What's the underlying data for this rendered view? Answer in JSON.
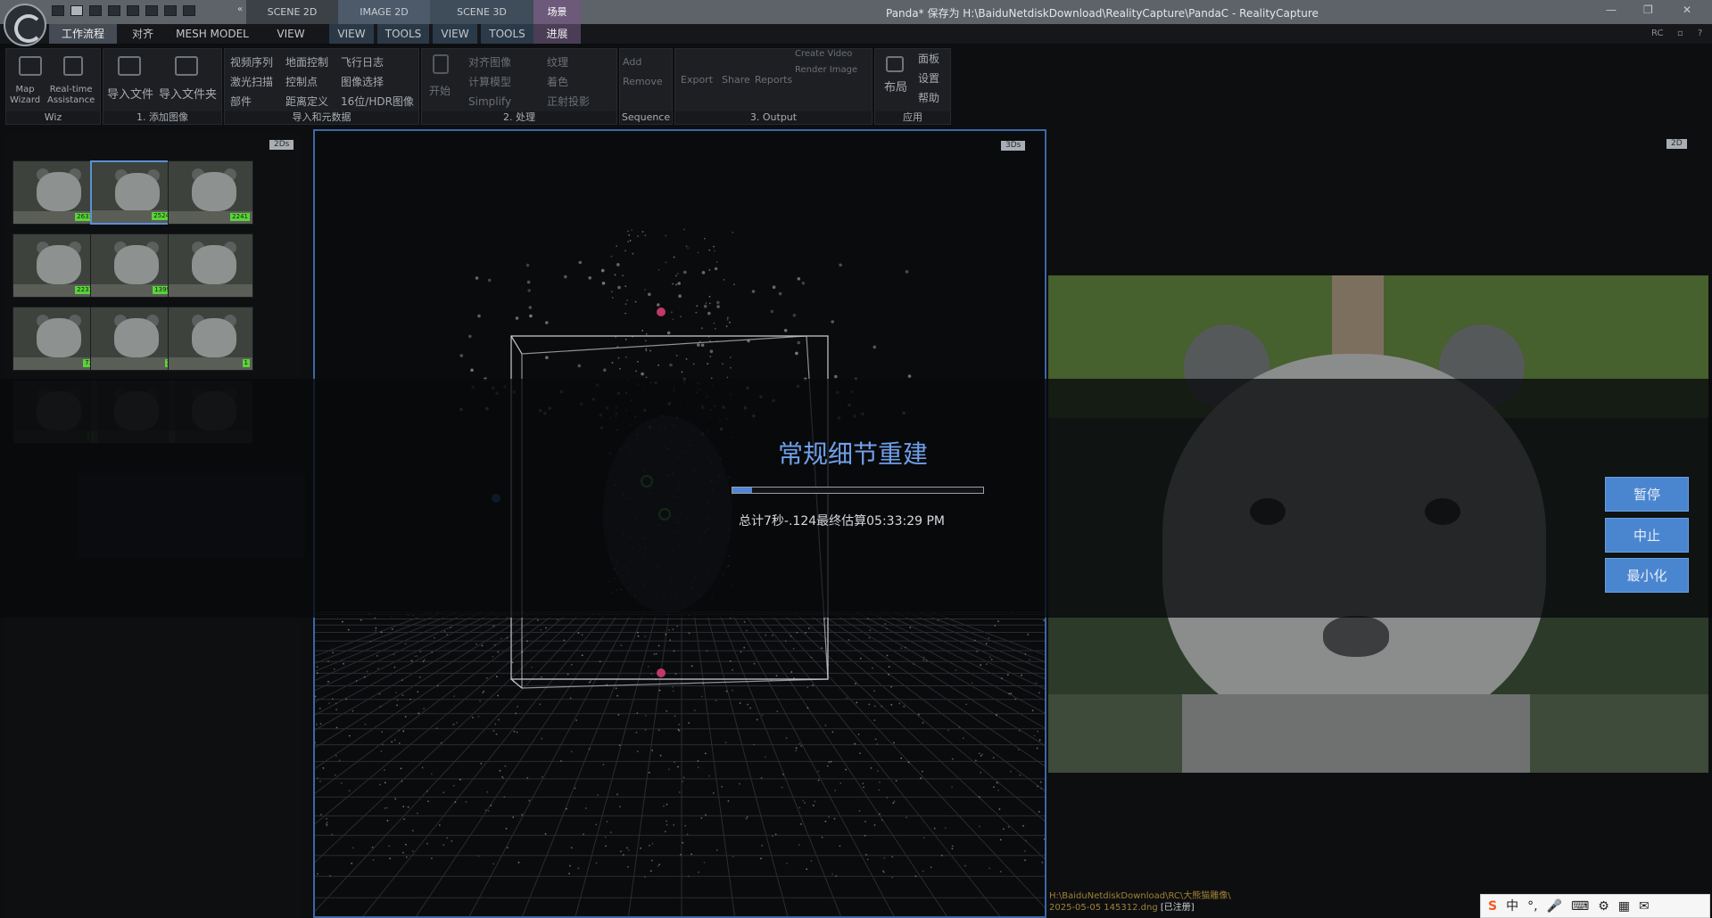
{
  "window": {
    "title": "Panda* 保存为 H:\\BaiduNetdiskDownload\\RealityCapture\\PandaC - RealityCapture",
    "quick_access": "«",
    "controls": [
      "—",
      "❐",
      "✕"
    ]
  },
  "top_tabs": [
    {
      "label": "SCENE 2D"
    },
    {
      "label": "IMAGE 2D"
    },
    {
      "label": "SCENE 3D"
    },
    {
      "label": "场景"
    }
  ],
  "menu": {
    "items": [
      "工作流程",
      "对齐",
      "MESH MODEL",
      "VIEW",
      "VIEW",
      "TOOLS",
      "VIEW",
      "TOOLS",
      "进展"
    ],
    "right": [
      "RC",
      "▫",
      "?"
    ]
  },
  "ribbon": {
    "wiz": {
      "label": "Wiz",
      "map_wizard": "Map\nWizard",
      "realtime": "Real-time\nAssistance"
    },
    "add_images": {
      "label": "1. 添加图像",
      "import_file": "导入文件",
      "import_folder": "导入文件夹"
    },
    "import_meta": {
      "label": "导入和元数据",
      "col1": [
        "视频序列",
        "激光扫描",
        "部件"
      ],
      "col2": [
        "地面控制",
        "控制点",
        "距离定义"
      ],
      "col3": [
        "飞行日志",
        "图像选择",
        "16位/HDR图像"
      ]
    },
    "process": {
      "label": "2. 处理",
      "start": "开始",
      "col1": [
        "对齐图像",
        "计算模型",
        "Simplify"
      ],
      "col2": [
        "纹理",
        "着色",
        "正射投影"
      ]
    },
    "sequence": {
      "label": "Sequence",
      "add": "Add",
      "remove": "Remove"
    },
    "output": {
      "label": "3. Output",
      "export": "Export",
      "share": "Share",
      "reports": "Reports",
      "create_video": "Create Video",
      "render_image": "Render Image"
    },
    "app": {
      "label": "应用",
      "layout": "布局",
      "items": [
        "面板",
        "设置",
        "帮助"
      ]
    }
  },
  "left_panel": {
    "tag": "2Ds",
    "thumbnails": [
      {
        "badge": "2633"
      },
      {
        "badge": "2524"
      },
      {
        "badge": "2241"
      },
      {
        "badge": "2231"
      },
      {
        "badge": "1399"
      },
      {
        "badge": ""
      },
      {
        "badge": "73"
      },
      {
        "badge": "1"
      },
      {
        "badge": "1"
      },
      {
        "badge": "1"
      },
      {
        "badge": ""
      },
      {
        "badge": ""
      }
    ]
  },
  "center_panel": {
    "tag": "3Ds"
  },
  "right_panel": {
    "tag": "2D"
  },
  "progress": {
    "title": "常规细节重建",
    "fraction": 0.08,
    "status": "总计7秒-.124最终估算05:33:29 PM",
    "buttons": {
      "pause": "暂停",
      "stop": "中止",
      "minimize": "最小化"
    }
  },
  "footer_path": {
    "line1": "H:\\BaiduNetdiskDownload\\RC\\大熊猫雕像\\",
    "line2": "2025-05-05 145312.dng",
    "registered": "[已注册]"
  },
  "ime": [
    "中",
    "°,",
    "🎤",
    "⌨",
    "⚙",
    "▦",
    "✉"
  ],
  "colors": {
    "accent": "#4a86d0",
    "selection": "#3c67a8",
    "badge": "#5bd23a"
  }
}
